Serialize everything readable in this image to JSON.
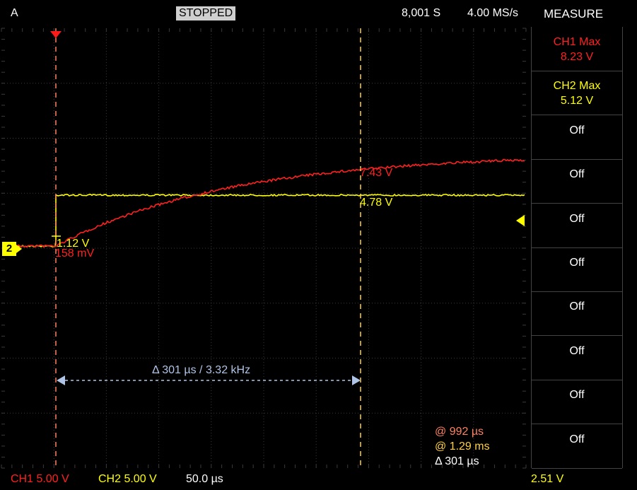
{
  "header": {
    "trigger_mode": "A",
    "status": "STOPPED",
    "sample_count": "8,001 S",
    "sample_rate": "4.00 MS/s",
    "panel_title": "MEASURE"
  },
  "measurements": [
    {
      "name": "CH1 Max",
      "value": "8.23 V",
      "color": "#ff2020"
    },
    {
      "name": "CH2 Max",
      "value": "5.12 V",
      "color": "#ffff00"
    },
    {
      "name": "Off",
      "value": "",
      "color": "#ffffff"
    },
    {
      "name": "Off",
      "value": "",
      "color": "#ffffff"
    },
    {
      "name": "Off",
      "value": "",
      "color": "#ffffff"
    },
    {
      "name": "Off",
      "value": "",
      "color": "#ffffff"
    },
    {
      "name": "Off",
      "value": "",
      "color": "#ffffff"
    },
    {
      "name": "Off",
      "value": "",
      "color": "#ffffff"
    },
    {
      "name": "Off",
      "value": "",
      "color": "#ffffff"
    },
    {
      "name": "Off",
      "value": "",
      "color": "#ffffff"
    }
  ],
  "cursors": {
    "cursor1_ch2": "1.12 V",
    "cursor1_ch1": "158 mV",
    "cursor2_ch1": "7.43 V",
    "cursor2_ch2": "4.78 V",
    "delta_label": "Δ 301 µs / 3.32 kHz",
    "readout_a": "@ 992 µs",
    "readout_b": "@ 1.29 ms",
    "readout_delta": "Δ 301 µs"
  },
  "channel_marker": "2",
  "footer": {
    "ch1_scale": "CH1 5.00 V",
    "ch2_scale": "CH2 5.00 V",
    "timebase": "50.0 µs",
    "trigger_level": "2.51 V"
  },
  "colors": {
    "ch1": "#ff2020",
    "ch2": "#ffff00",
    "cursor1": "#ff8060",
    "cursor2": "#ffd040",
    "delta": "#b0c4e8",
    "grid": "#3a3a3a"
  }
}
